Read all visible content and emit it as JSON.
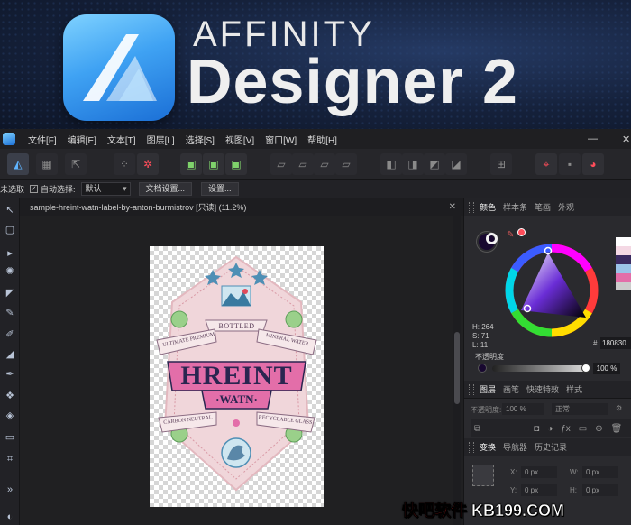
{
  "banner": {
    "brand_top": "AFFINITY",
    "brand_main": "Designer 2"
  },
  "menubar": {
    "items": [
      "文件[F]",
      "编辑[E]",
      "文本[T]",
      "图层[L]",
      "选择[S]",
      "视图[V]",
      "窗口[W]",
      "帮助[H]"
    ],
    "minimize": "—",
    "close": "✕"
  },
  "context_bar": {
    "unselected": "未选取",
    "auto_select_label": "自动选择:",
    "auto_select_value": "默认",
    "document_setup": "文档设置...",
    "settings": "设置..."
  },
  "document": {
    "tab_title": "sample-hreint-watn-label-by-anton-burmistrov [只读] (11.2%)",
    "tab_close": "✕"
  },
  "artwork": {
    "bottled": "BOTTLED",
    "ultimate_premium": "ULTIMATE PREMIUM",
    "mineral_water": "MINERAL WATER",
    "hreint": "HREINT",
    "watn": "·WATN·",
    "carbon_neutral": "CARBON NEUTRAL",
    "recyclable_glass": "RECYCLABLE GLASS"
  },
  "color_panel": {
    "tabs": [
      "颜色",
      "样本条",
      "笔画",
      "外观"
    ],
    "h": "H: 264",
    "s": "S: 71",
    "l": "L: 11",
    "hex": "180830",
    "opacity_label": "不透明度",
    "opacity_value": "100 %",
    "current_color": "#180830"
  },
  "layers_panel": {
    "tabs": [
      "图层",
      "画笔",
      "快速特效",
      "样式"
    ],
    "opacity_label": "不透明度:",
    "opacity_value": "100 %",
    "blend_mode": "正常"
  },
  "transform_panel": {
    "tabs": [
      "变换",
      "导航器",
      "历史记录"
    ],
    "x_label": "X:",
    "x_value": "0 px",
    "y_label": "Y:",
    "y_value": "0 px",
    "w_label": "W:",
    "w_value": "0 px",
    "h_label": "H:",
    "h_value": "0 px"
  },
  "watermark": {
    "cn": "快吧软件",
    "site": "KB199.COM"
  },
  "colors": {
    "accent": "#4fa8ff",
    "label_pink": "#f0d6da",
    "label_magenta": "#e36ea9",
    "label_navy": "#2a2550"
  }
}
